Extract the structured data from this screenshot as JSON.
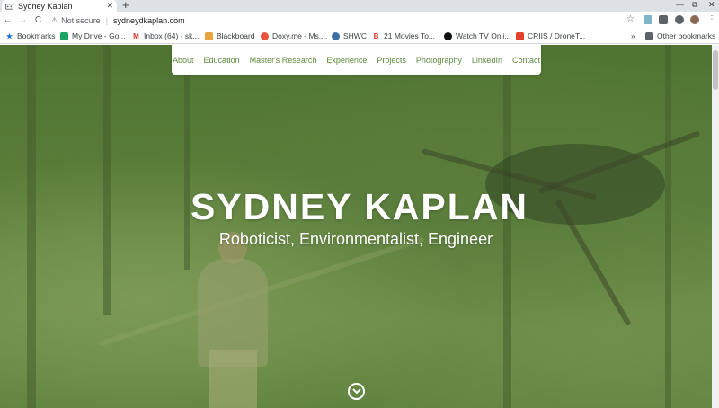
{
  "browser": {
    "tab_title": "Sydney Kaplan",
    "tab_close": "✕",
    "new_tab": "+",
    "window_minimize": "—",
    "window_restore": "⧉",
    "window_close": "✕",
    "security_label": "Not secure",
    "url": "sydneydkaplan.com",
    "nav": {
      "back": "←",
      "forward": "→",
      "reload": "C"
    },
    "bookmarks": [
      {
        "label": "Bookmarks",
        "icon": "star-icon",
        "color": "#1a73e8"
      },
      {
        "label": "My Drive - Go...",
        "icon": "drive-icon",
        "color": "#1fa463"
      },
      {
        "label": "Inbox (64) - sk...",
        "icon": "gmail-icon",
        "color": "#d93025"
      },
      {
        "label": "Blackboard",
        "icon": "blackboard-icon",
        "color": "#e8a33d"
      },
      {
        "label": "Doxy.me - Ms....",
        "icon": "doxy-icon",
        "color": "#e8543d"
      },
      {
        "label": "SHWC",
        "icon": "globe-icon",
        "color": "#3a6ea5"
      },
      {
        "label": "21 Movies To...",
        "icon": "b-icon",
        "color": "#d93025"
      },
      {
        "label": "Watch TV Onli...",
        "icon": "play-icon",
        "color": "#111111"
      },
      {
        "label": "CRIIS / DroneT...",
        "icon": "gitlab-icon",
        "color": "#e24329"
      }
    ],
    "bookmarks_overflow": "»",
    "other_bookmarks": "Other bookmarks"
  },
  "site": {
    "nav_items": [
      "About",
      "Education",
      "Master's Research",
      "Experience",
      "Projects",
      "Photography",
      "LinkedIn",
      "Contact"
    ],
    "hero_title": "SYDNEY KAPLAN",
    "hero_subtitle": "Roboticist, Environmentalist, Engineer",
    "accent_color": "#5d8a3a"
  }
}
